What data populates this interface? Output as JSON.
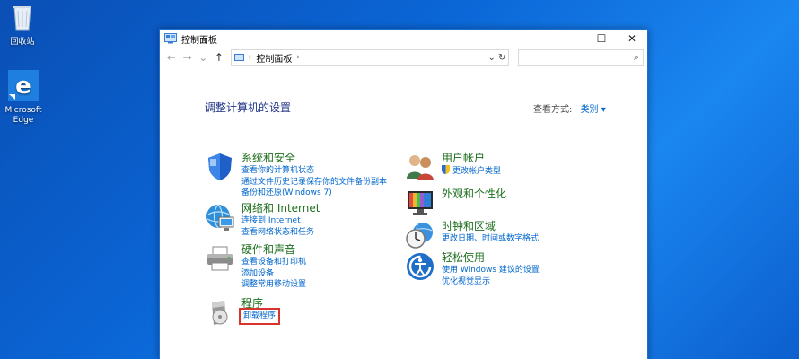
{
  "desktop": {
    "recycle_label": "回收站",
    "edge_label": "Microsoft Edge"
  },
  "window": {
    "title": "控制面板",
    "controls": {
      "minimize": "—",
      "maximize": "☐",
      "close": "✕"
    }
  },
  "address": {
    "crumb": "控制面板",
    "back": "←",
    "forward": "→",
    "up": "↑",
    "dropdown": "⌄",
    "refresh": "↻",
    "search_icon": "⌕"
  },
  "main": {
    "heading": "调整计算机的设置",
    "view_by_label": "查看方式:",
    "view_by_value": "类别 ▾"
  },
  "categories": [
    {
      "icon": "shield-icon",
      "title": "系统和安全",
      "links": [
        "查看你的计算机状态",
        "通过文件历史记录保存你的文件备份副本",
        "备份和还原(Windows 7)"
      ]
    },
    {
      "icon": "globe-network-icon",
      "title": "网络和 Internet",
      "links": [
        "连接到 Internet",
        "查看网络状态和任务"
      ]
    },
    {
      "icon": "printer-icon",
      "title": "硬件和声音",
      "links": [
        "查看设备和打印机",
        "添加设备",
        "调整常用移动设置"
      ]
    },
    {
      "icon": "programs-icon",
      "title": "程序",
      "links": [
        "卸载程序"
      ]
    },
    {
      "icon": "users-icon",
      "title": "用户帐户",
      "links": [
        "更改帐户类型"
      ]
    },
    {
      "icon": "display-icon",
      "title": "外观和个性化",
      "links": []
    },
    {
      "icon": "clock-globe-icon",
      "title": "时钟和区域",
      "links": [
        "更改日期、时间或数字格式"
      ]
    },
    {
      "icon": "ease-of-access-icon",
      "title": "轻松使用",
      "links": [
        "使用 Windows 建议的设置",
        "优化视觉显示"
      ]
    }
  ],
  "colors": {
    "desktop_blue": "#0b66d6",
    "title_green": "#1c6e1c",
    "link_blue": "#0066cc",
    "heading_navy": "#1e3287",
    "highlight_red": "#d9342b"
  }
}
